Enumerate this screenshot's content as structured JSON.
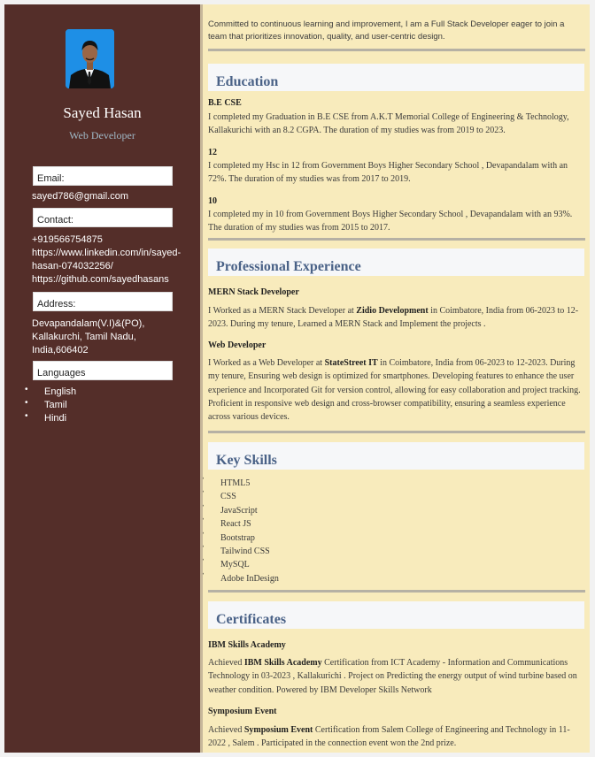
{
  "sidebar": {
    "name": "Sayed Hasan",
    "role": "Web Developer",
    "email_label": "Email:",
    "email": "sayed786@gmail.com",
    "contact_label": "Contact:",
    "contact": [
      "+919566754875",
      "https://www.linkedin.com/in/sayed-",
      "hasan-074032256/",
      "https://github.com/sayedhasans"
    ],
    "address_label": "Address:",
    "address": [
      "Devapandalam(V.I)&(PO),",
      "Kallakurchi, Tamil Nadu,",
      "India,606402"
    ],
    "languages_label": "Languages",
    "languages": [
      "English",
      "Tamil",
      "Hindi"
    ]
  },
  "main": {
    "intro": "Committed to continuous learning and improvement, I am a Full Stack Developer eager to join a team that prioritizes innovation, quality, and user-centric design.",
    "education": {
      "heading": "Education",
      "items": [
        {
          "title": "B.E CSE",
          "text": "I completed my Graduation in B.E CSE from A.K.T Memorial College of Engineering & Technology, Kallakurichi with an 8.2 CGPA. The duration of my studies was from 2019 to 2023."
        },
        {
          "title": "12",
          "text": "I completed my Hsc in 12 from Government Boys Higher Secondary School , Devapandalam with an 72%. The duration of my studies was from 2017 to 2019."
        },
        {
          "title": "10",
          "text": "I completed my in 10 from Government Boys Higher Secondary School , Devapandalam with an 93%. The duration of my studies was from 2015 to 2017."
        }
      ]
    },
    "experience": {
      "heading": "Professional Experience",
      "items": [
        {
          "title": "MERN Stack Developer",
          "pre": "I Worked as a MERN Stack Developer at ",
          "company": "Zidio Development",
          "post": " in Coimbatore, India from 06-2023 to 12-2023. During my tenure, Learned a MERN Stack and Implement the projects ."
        },
        {
          "title": "Web Developer",
          "pre": "I Worked as a Web Developer at ",
          "company": "StateStreet IT",
          "post": " in Coimbatore, India from 06-2023 to 12-2023. During my tenure, Ensuring web design is optimized for smartphones. Developing features to enhance the user experience and Incorporated Git for version control, allowing for easy collaboration and project tracking. Proficient in responsive web design and cross-browser compatibility, ensuring a seamless experience across various devices."
        }
      ]
    },
    "skills": {
      "heading": "Key Skills",
      "items": [
        "HTML5",
        "CSS",
        "JavaScript",
        "React JS",
        "Bootstrap",
        "Tailwind CSS",
        "MySQL",
        "Adobe InDesign"
      ]
    },
    "certificates": {
      "heading": "Certificates",
      "items": [
        {
          "title": "IBM Skills Academy",
          "pre": "Achieved ",
          "org": "IBM Skills Academy",
          "post": " Certification from ICT Academy - Information and Communications Technology in 03-2023 , Kallakurichi . Project on Predicting the energy output of wind turbine based on weather condition. Powered by IBM Developer Skills Network"
        },
        {
          "title": "Symposium Event",
          "pre": "Achieved ",
          "org": "Symposium Event",
          "post": " Certification from Salem College of Engineering and Technology in 11-2022 , Salem . Participated in the connection event won the 2nd prize."
        }
      ]
    }
  },
  "colors": {
    "sidebar_bg": "#542e29",
    "main_bg": "#f8ebbc",
    "heading": "#4a6287"
  }
}
